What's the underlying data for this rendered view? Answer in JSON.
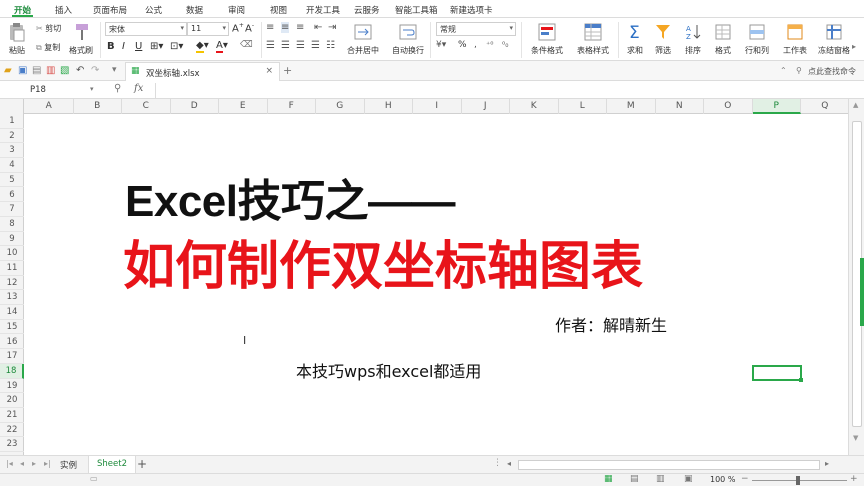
{
  "menu": {
    "tabs": [
      "开始",
      "插入",
      "页面布局",
      "公式",
      "数据",
      "审阅",
      "视图",
      "开发工具",
      "云服务",
      "智能工具箱",
      "新建选项卡"
    ],
    "active": "开始"
  },
  "ribbon": {
    "paste": "粘贴",
    "cut": "剪切",
    "copy": "复制",
    "format_painter": "格式刷",
    "font_name": "宋体",
    "font_size": "11",
    "bold": "B",
    "italic": "I",
    "underline": "U",
    "font_color_letter": "A",
    "merge_center": "合并居中",
    "wrap_text": "自动换行",
    "number_format": "常规",
    "percent": "%",
    "conditional_format": "条件格式",
    "table_style": "表格样式",
    "sum": "求和",
    "filter": "筛选",
    "sort": "排序",
    "format": "格式",
    "rows_cols": "行和列",
    "worksheet": "工作表",
    "freeze": "冻结窗格",
    "search_cmd": "点此查找命令"
  },
  "document": {
    "filename": "双坐标轴.xlsx",
    "close": "×",
    "new_tab": "+"
  },
  "formula_bar": {
    "cell_ref": "P18",
    "fx": "fx",
    "content": ""
  },
  "grid": {
    "columns": [
      "A",
      "B",
      "C",
      "D",
      "E",
      "F",
      "G",
      "H",
      "I",
      "J",
      "K",
      "L",
      "M",
      "N",
      "O",
      "P",
      "Q"
    ],
    "selected_column": "P",
    "rows": [
      "1",
      "2",
      "3",
      "4",
      "5",
      "6",
      "7",
      "8",
      "9",
      "10",
      "11",
      "12",
      "13",
      "14",
      "15",
      "16",
      "17",
      "18",
      "19",
      "20",
      "21",
      "22",
      "23"
    ],
    "selected_row": "18"
  },
  "content": {
    "title_line1": "Excel技巧之——",
    "title_line2": "如何制作双坐标轴图表",
    "author": "作者：解晴新生",
    "note": "本技巧wps和excel都适用"
  },
  "sheets": {
    "tabs": [
      "实例",
      "Sheet2"
    ],
    "active": "Sheet2",
    "add": "+"
  },
  "status": {
    "zoom": "100 %"
  },
  "colors": {
    "accent_green": "#2aa84a",
    "title_red": "#e8141a"
  }
}
